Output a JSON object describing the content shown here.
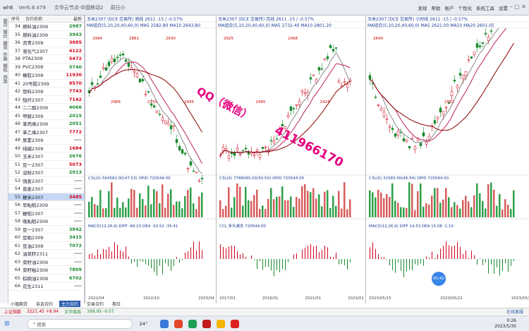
{
  "titlebar": {
    "app": "wh6",
    "version": "Ver6.8.479",
    "document": "文华云节点·中国移动2",
    "cycle": "周日小",
    "menus": [
      "发现",
      "帮助",
      "账户",
      "个性化",
      "系统工具",
      "设置"
    ]
  },
  "vtabs": [
    "首页",
    "报价",
    "期货",
    "外盘",
    "期权",
    "自选"
  ],
  "watchlist": {
    "headers": [
      "序号",
      "合约名称",
      "最新"
    ],
    "rows": [
      {
        "n": "34",
        "name": "燃料油2309",
        "price": "2987",
        "c": "dn"
      },
      {
        "n": "35",
        "name": "燃料油2309",
        "price": "3943",
        "c": "dn"
      },
      {
        "n": "36",
        "name": "沥青2309",
        "price": "3685",
        "c": "up"
      },
      {
        "n": "37",
        "name": "液化气2307",
        "price": "4122",
        "c": "up"
      },
      {
        "n": "38",
        "name": "PTA2309",
        "price": "5472",
        "c": "up"
      },
      {
        "n": "39",
        "name": "PVC2309",
        "price": "5740",
        "c": "dn"
      },
      {
        "n": "40",
        "name": "橡胶2309",
        "price": "11930",
        "c": "up"
      },
      {
        "n": "41",
        "name": "20号胶2309",
        "price": "9570",
        "c": "up"
      },
      {
        "n": "42",
        "name": "塑料2309",
        "price": "7743",
        "c": "up"
      },
      {
        "n": "43",
        "name": "短纤2307",
        "price": "7142",
        "c": "up"
      },
      {
        "n": "44",
        "name": "二二醇2309",
        "price": "4066",
        "c": "dn"
      },
      {
        "n": "45",
        "name": "甲醇2309",
        "price": "2015",
        "c": "dn"
      },
      {
        "n": "46",
        "name": "苯丙烯2309",
        "price": "2051",
        "c": "dn"
      },
      {
        "n": "47",
        "name": "苯乙烯2307",
        "price": "7772",
        "c": "up"
      },
      {
        "n": "48",
        "name": "尿素2309",
        "price": "----",
        "c": "fl"
      },
      {
        "n": "49",
        "name": "纯碱2309",
        "price": "1684",
        "c": "up"
      },
      {
        "n": "50",
        "name": "玉米2307",
        "price": "2676",
        "c": "dn"
      },
      {
        "n": "51",
        "name": "豆一2307",
        "price": "5073",
        "c": "up"
      },
      {
        "n": "52",
        "name": "淀粉2307",
        "price": "2913",
        "c": "dn"
      },
      {
        "n": "53",
        "name": "强麦2307",
        "price": "----",
        "c": "fl"
      },
      {
        "n": "54",
        "name": "普麦2307",
        "price": "----",
        "c": "fl"
      },
      {
        "n": "55",
        "name": "粳米2307",
        "price": "3485",
        "c": "up"
      },
      {
        "n": "56",
        "name": "早籼稻2309",
        "price": "----",
        "c": "fl"
      },
      {
        "n": "57",
        "name": "粳稻2307",
        "price": "----",
        "c": "fl"
      },
      {
        "n": "58",
        "name": "晚籼稻2309",
        "price": "----",
        "c": "fl"
      },
      {
        "n": "59",
        "name": "豆一2307",
        "price": "3842",
        "c": "dn"
      },
      {
        "n": "60",
        "name": "豆粕2309",
        "price": "3415",
        "c": "dn"
      },
      {
        "n": "61",
        "name": "豆油2309",
        "price": "7072",
        "c": "dn"
      },
      {
        "n": "62",
        "name": "油菜籽2311",
        "price": "----",
        "c": "fl"
      },
      {
        "n": "63",
        "name": "菜籽油2309",
        "price": "----",
        "c": "fl"
      },
      {
        "n": "64",
        "name": "菜籽粕2309",
        "price": "7809",
        "c": "dn"
      },
      {
        "n": "65",
        "name": "棕榈油2309",
        "price": "6702",
        "c": "dn"
      },
      {
        "n": "66",
        "name": "花生2311",
        "price": "----",
        "c": "fl"
      }
    ]
  },
  "panels": [
    {
      "header": "玉米2307 (DCE 交易所) 周线  2611  -15 / -0.57%",
      "ma": "MA组合(5,10,20,40,60,0)  MA5 2582.80  MA10 2643.80",
      "vol": "C3L(0)  564582.00(47:53)  OPID 720544.00",
      "macd": "MACD(12,26,9)  DIFF -68.23  DEA -50.52  -35.41",
      "highs": [
        "2994",
        "2966",
        "2881",
        "2750",
        "2630",
        "2495"
      ],
      "dates": [
        "2022/04",
        "2022/10",
        "2023/04"
      ]
    },
    {
      "header": "玉米2307 (DCE 交易所) 月线  2611  -15 / -0.57%",
      "ma": "MA组合(5,10,20,40,60,0)  MA5 2732.40  MA10 2801.20",
      "vol": "C3L(0)  7786065.00(50:50)  OPID 720544.00",
      "macd": "CCL  多头减仓  720544.00",
      "highs": [
        "2925",
        "2495",
        "2068",
        "1424"
      ],
      "dates": [
        "2017/01",
        "2019/01",
        "2021/01",
        "2023/01"
      ]
    },
    {
      "header": "玉米2307 (DCE 交易所) 小时线  2611  -15 / -0.57%",
      "ma": "MA组合(5,10,20,40,60,0)  MA5 2621.00  MA10  MA20 2601.05",
      "vol": "C3L(0)  31583.00(46:54)  OPID 720544.00",
      "macd": "MACD(12,26,9)  DIFF 14.53  DEA 15.08  -1.10",
      "highs": [
        "2640",
        "2562"
      ],
      "dates": [
        "2023/05/15",
        "2023/05/22",
        "2023/05/29"
      ]
    }
  ],
  "overlay": {
    "line1": "QQ（微信）",
    "line2": "411966170"
  },
  "bottomtabs": [
    "小幅期货",
    "自选合约",
    "主力合约",
    "交易合约",
    "期日"
  ],
  "status": {
    "idx": "上证指数",
    "idxval": "3221.45 +8.94",
    "idx2": "文华商品",
    "idx2val": "169.95 -0.07",
    "right": "在线客服"
  },
  "taskbar": {
    "search": "搜索",
    "temp": "24°",
    "time": "0:26",
    "date": "2023/5/30"
  },
  "bubble": "05:42",
  "colors": {
    "up": "#d0021b",
    "down": "#1b8a2f",
    "ma1": "#bb2266",
    "ma2": "#8a0000",
    "accent": "#2a5db0"
  }
}
